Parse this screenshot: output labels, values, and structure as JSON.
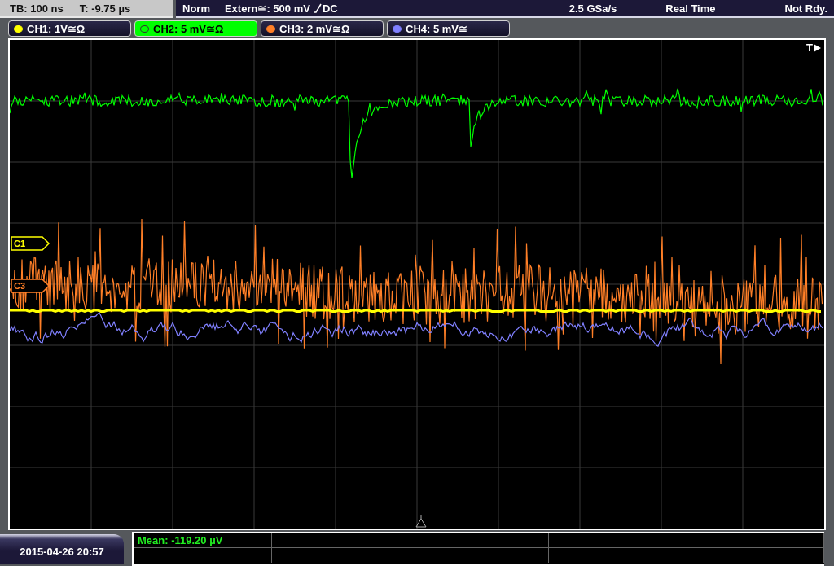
{
  "top_bar": {
    "timebase": "TB: 100 ns",
    "trigger_time": "T: -9.75 µs",
    "mode": "Norm",
    "trigger_source": "Extern≅: 500 mV",
    "trigger_coupling": "DC",
    "sample_rate": "2.5 GSa/s",
    "acquisition": "Real Time",
    "status": "Not Rdy."
  },
  "channels": [
    {
      "label": "CH1: 1V≅Ω",
      "selected": false,
      "color": "#ffff00"
    },
    {
      "label": "CH2: 5 mV≅Ω",
      "selected": true,
      "color": "#00ff00"
    },
    {
      "label": "CH3: 2 mV≅Ω",
      "selected": false,
      "color": "#ff7f27"
    },
    {
      "label": "CH4: 5 mV≅",
      "selected": false,
      "color": "#8080ff"
    }
  ],
  "markers": [
    {
      "label": "C1",
      "color": "#ffff00"
    },
    {
      "label": "C3",
      "color": "#ff7f27"
    }
  ],
  "trigger_marker": "T",
  "measurements": [
    {
      "text": "Mean: -119.20 µV"
    }
  ],
  "datetime": "2015-04-26 20:57"
}
